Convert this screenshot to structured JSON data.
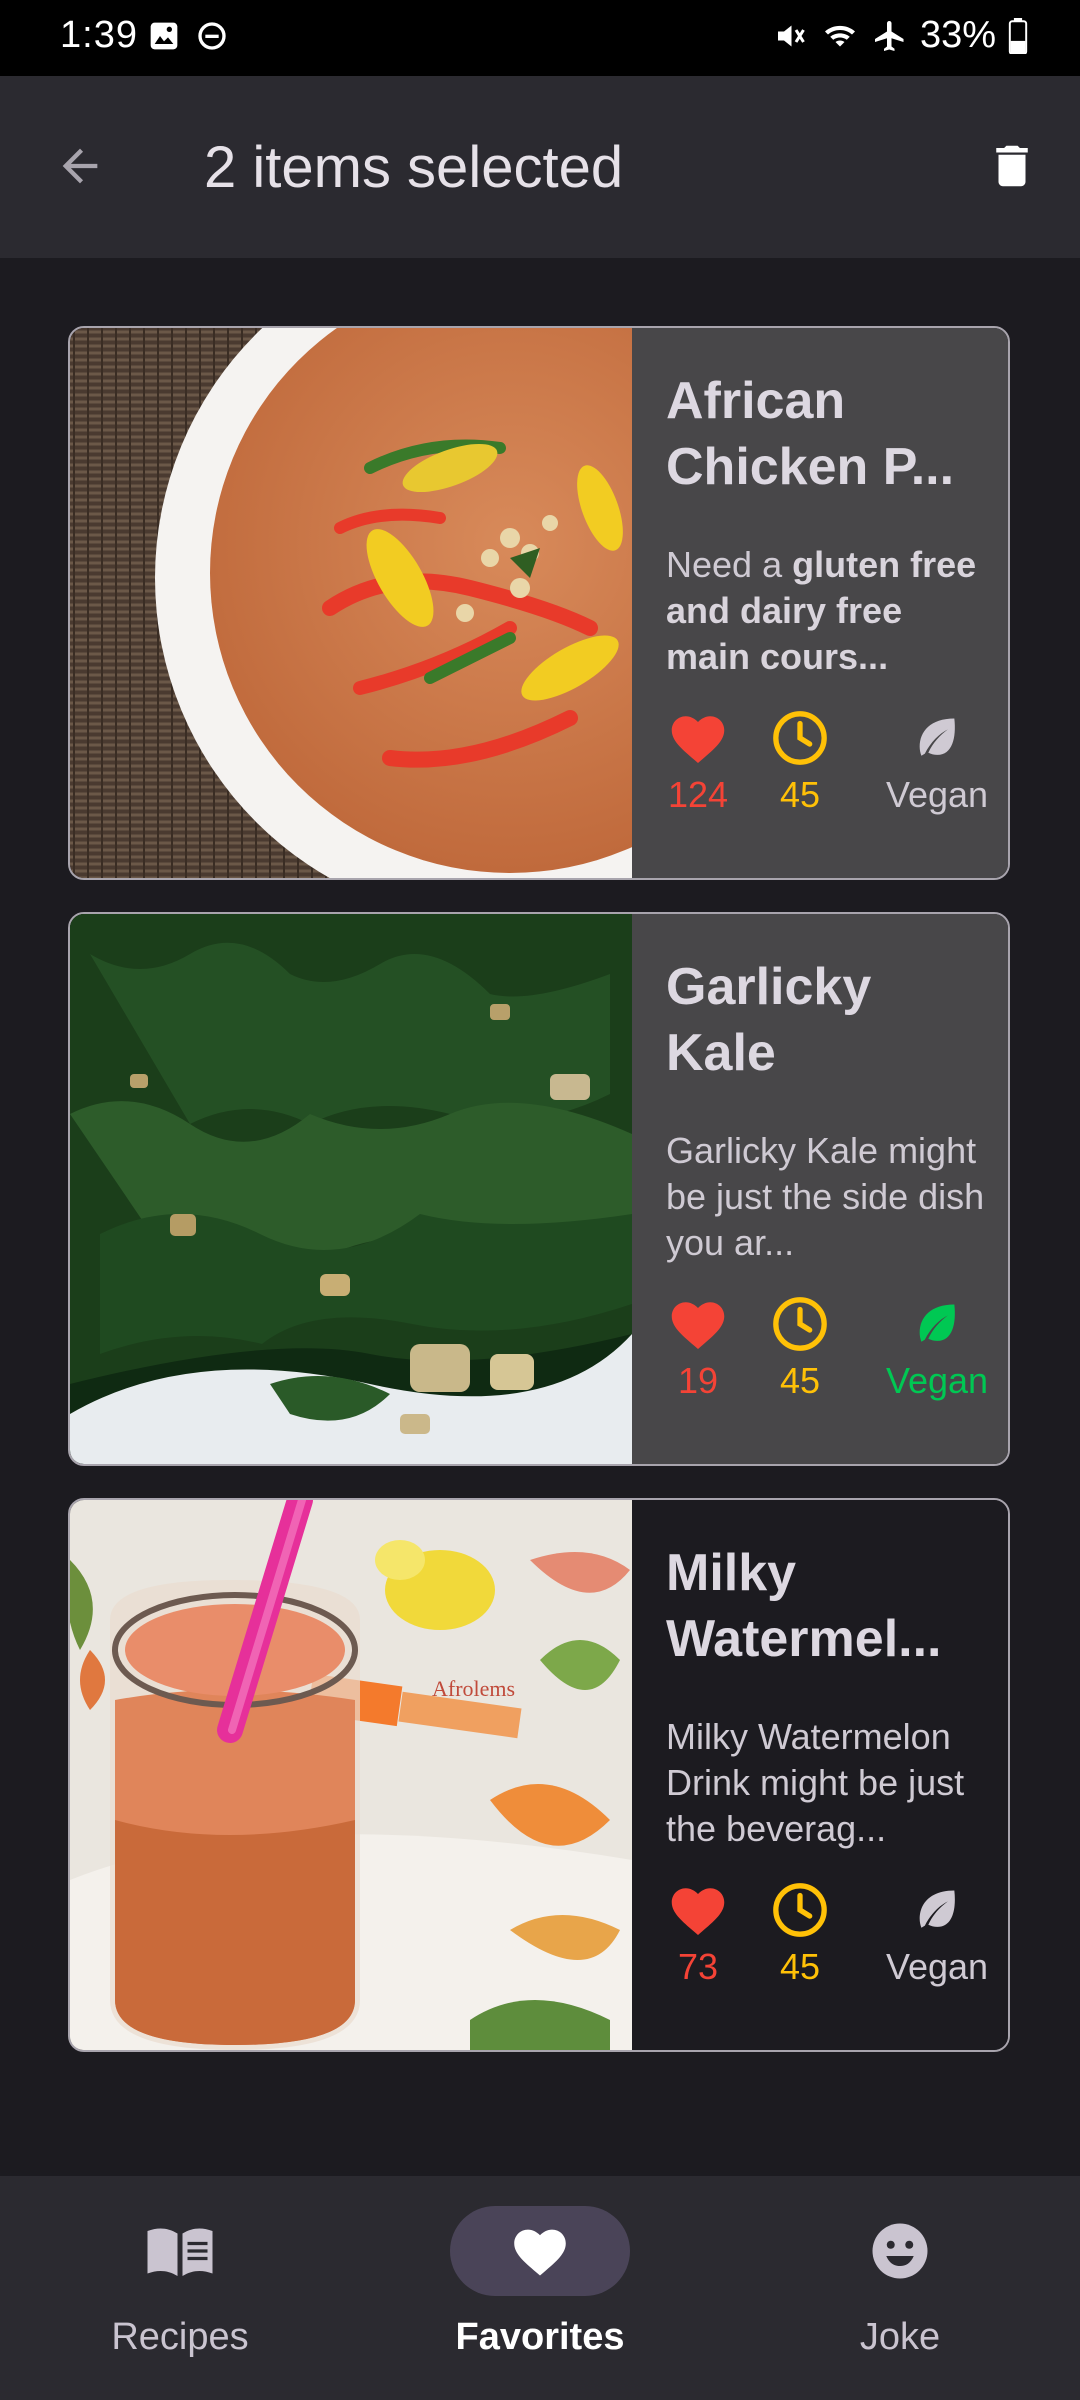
{
  "status_bar": {
    "time": "1:39",
    "battery": "33%",
    "icons": [
      "image-icon",
      "dnd-icon",
      "mute-icon",
      "wifi-icon",
      "airplane-icon",
      "battery-icon"
    ]
  },
  "app_bar": {
    "title": "2 items selected",
    "back_icon": "arrow-back-icon",
    "delete_icon": "trash-icon"
  },
  "recipes": [
    {
      "title": "African Chicken P...",
      "title_lines": [
        "African",
        "Chicken P..."
      ],
      "desc_plain_1": "Need a ",
      "desc_bold": "gluten free and dairy free main cours...",
      "likes": "124",
      "time": "45",
      "vegan_label": "Vegan",
      "vegan": false,
      "selected": true
    },
    {
      "title": "Garlicky Kale",
      "title_lines": [
        "Garlicky",
        "Kale"
      ],
      "desc": "Garlicky Kale might be just the side dish you ar...",
      "likes": "19",
      "time": "45",
      "vegan_label": "Vegan",
      "vegan": true,
      "selected": true
    },
    {
      "title": "Milky Watermel...",
      "title_lines": [
        "Milky",
        "Watermel..."
      ],
      "desc": "Milky Watermelon Drink might be just the beverag...",
      "image_watermark": "Afrolems",
      "likes": "73",
      "time": "45",
      "vegan_label": "Vegan",
      "vegan": false,
      "selected": false
    }
  ],
  "bottom_nav": {
    "items": [
      {
        "label": "Recipes",
        "icon": "book-icon",
        "active": false
      },
      {
        "label": "Favorites",
        "icon": "heart-icon",
        "active": true
      },
      {
        "label": "Joke",
        "icon": "smiley-icon",
        "active": false
      }
    ]
  },
  "colors": {
    "like": "#f44336",
    "time": "#ffc107",
    "vegan_on": "#00c853",
    "vegan_off": "#cfcad3"
  }
}
